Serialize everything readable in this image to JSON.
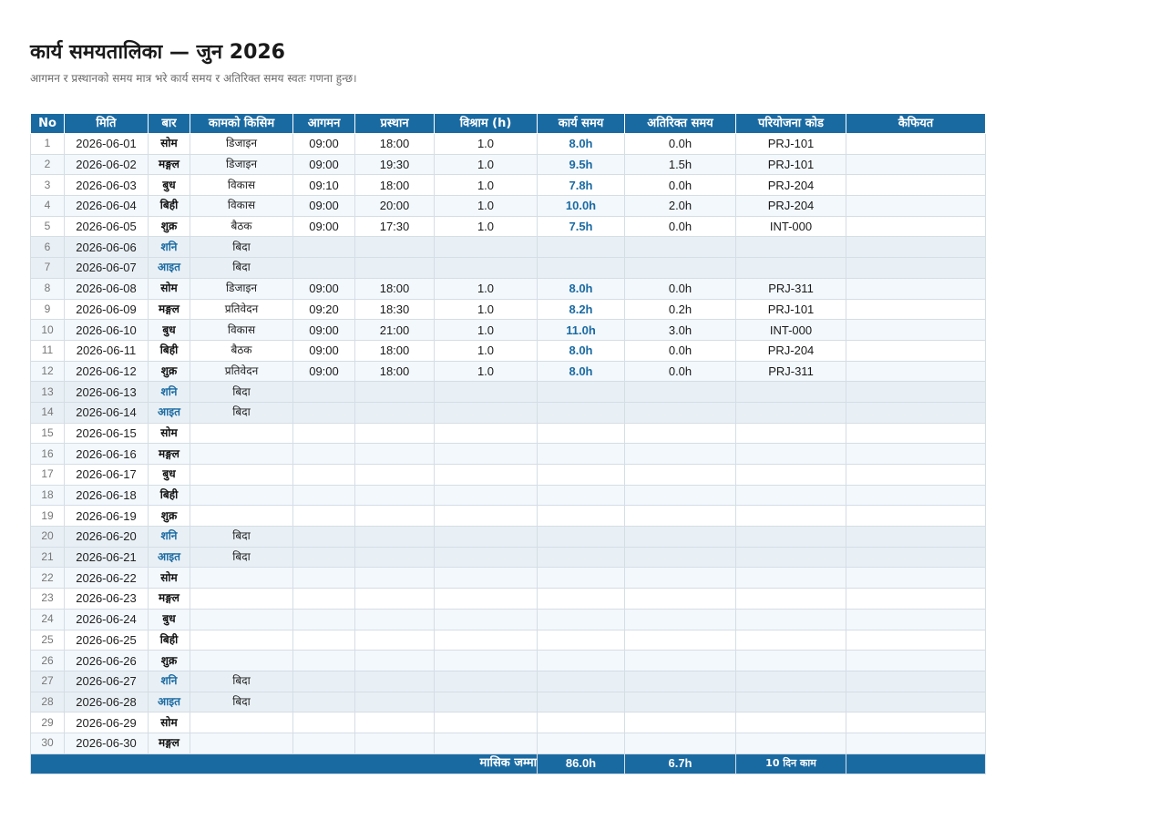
{
  "title": "कार्य समयतालिका — जुन 2026",
  "subtitle": "आगमन र प्रस्थानको समय मात्र भरे कार्य समय र अतिरिक्त समय स्वतः गणना हुन्छ।",
  "colors": {
    "header_bg": "#1a6aa2",
    "accent": "#1a6aa2",
    "weekend_row": "#e9f0f5",
    "alt_row": "#f3f8fc"
  },
  "columns": [
    "No",
    "मिति",
    "बार",
    "कामको किसिम",
    "आगमन",
    "प्रस्थान",
    "विश्राम (h)",
    "कार्य समय",
    "अतिरिक्त समय",
    "परियोजना कोड",
    "कैफियत"
  ],
  "rows": [
    {
      "no": "1",
      "date": "2026-06-01",
      "weekday": "सोम",
      "weekend": false,
      "type": "डिजाइन",
      "in": "09:00",
      "out": "18:00",
      "break": "1.0",
      "work": "8.0h",
      "overtime": "0.0h",
      "project": "PRJ-101",
      "note": ""
    },
    {
      "no": "2",
      "date": "2026-06-02",
      "weekday": "मङ्गल",
      "weekend": false,
      "type": "डिजाइन",
      "in": "09:00",
      "out": "19:30",
      "break": "1.0",
      "work": "9.5h",
      "overtime": "1.5h",
      "project": "PRJ-101",
      "note": ""
    },
    {
      "no": "3",
      "date": "2026-06-03",
      "weekday": "बुध",
      "weekend": false,
      "type": "विकास",
      "in": "09:10",
      "out": "18:00",
      "break": "1.0",
      "work": "7.8h",
      "overtime": "0.0h",
      "project": "PRJ-204",
      "note": ""
    },
    {
      "no": "4",
      "date": "2026-06-04",
      "weekday": "बिही",
      "weekend": false,
      "type": "विकास",
      "in": "09:00",
      "out": "20:00",
      "break": "1.0",
      "work": "10.0h",
      "overtime": "2.0h",
      "project": "PRJ-204",
      "note": ""
    },
    {
      "no": "5",
      "date": "2026-06-05",
      "weekday": "शुक्र",
      "weekend": false,
      "type": "बैठक",
      "in": "09:00",
      "out": "17:30",
      "break": "1.0",
      "work": "7.5h",
      "overtime": "0.0h",
      "project": "INT-000",
      "note": ""
    },
    {
      "no": "6",
      "date": "2026-06-06",
      "weekday": "शनि",
      "weekend": true,
      "type": "बिदा",
      "in": "",
      "out": "",
      "break": "",
      "work": "",
      "overtime": "",
      "project": "",
      "note": ""
    },
    {
      "no": "7",
      "date": "2026-06-07",
      "weekday": "आइत",
      "weekend": true,
      "type": "बिदा",
      "in": "",
      "out": "",
      "break": "",
      "work": "",
      "overtime": "",
      "project": "",
      "note": ""
    },
    {
      "no": "8",
      "date": "2026-06-08",
      "weekday": "सोम",
      "weekend": false,
      "type": "डिजाइन",
      "in": "09:00",
      "out": "18:00",
      "break": "1.0",
      "work": "8.0h",
      "overtime": "0.0h",
      "project": "PRJ-311",
      "note": ""
    },
    {
      "no": "9",
      "date": "2026-06-09",
      "weekday": "मङ्गल",
      "weekend": false,
      "type": "प्रतिवेदन",
      "in": "09:20",
      "out": "18:30",
      "break": "1.0",
      "work": "8.2h",
      "overtime": "0.2h",
      "project": "PRJ-101",
      "note": ""
    },
    {
      "no": "10",
      "date": "2026-06-10",
      "weekday": "बुध",
      "weekend": false,
      "type": "विकास",
      "in": "09:00",
      "out": "21:00",
      "break": "1.0",
      "work": "11.0h",
      "overtime": "3.0h",
      "project": "INT-000",
      "note": ""
    },
    {
      "no": "11",
      "date": "2026-06-11",
      "weekday": "बिही",
      "weekend": false,
      "type": "बैठक",
      "in": "09:00",
      "out": "18:00",
      "break": "1.0",
      "work": "8.0h",
      "overtime": "0.0h",
      "project": "PRJ-204",
      "note": ""
    },
    {
      "no": "12",
      "date": "2026-06-12",
      "weekday": "शुक्र",
      "weekend": false,
      "type": "प्रतिवेदन",
      "in": "09:00",
      "out": "18:00",
      "break": "1.0",
      "work": "8.0h",
      "overtime": "0.0h",
      "project": "PRJ-311",
      "note": ""
    },
    {
      "no": "13",
      "date": "2026-06-13",
      "weekday": "शनि",
      "weekend": true,
      "type": "बिदा",
      "in": "",
      "out": "",
      "break": "",
      "work": "",
      "overtime": "",
      "project": "",
      "note": ""
    },
    {
      "no": "14",
      "date": "2026-06-14",
      "weekday": "आइत",
      "weekend": true,
      "type": "बिदा",
      "in": "",
      "out": "",
      "break": "",
      "work": "",
      "overtime": "",
      "project": "",
      "note": ""
    },
    {
      "no": "15",
      "date": "2026-06-15",
      "weekday": "सोम",
      "weekend": false,
      "type": "",
      "in": "",
      "out": "",
      "break": "",
      "work": "",
      "overtime": "",
      "project": "",
      "note": ""
    },
    {
      "no": "16",
      "date": "2026-06-16",
      "weekday": "मङ्गल",
      "weekend": false,
      "type": "",
      "in": "",
      "out": "",
      "break": "",
      "work": "",
      "overtime": "",
      "project": "",
      "note": ""
    },
    {
      "no": "17",
      "date": "2026-06-17",
      "weekday": "बुध",
      "weekend": false,
      "type": "",
      "in": "",
      "out": "",
      "break": "",
      "work": "",
      "overtime": "",
      "project": "",
      "note": ""
    },
    {
      "no": "18",
      "date": "2026-06-18",
      "weekday": "बिही",
      "weekend": false,
      "type": "",
      "in": "",
      "out": "",
      "break": "",
      "work": "",
      "overtime": "",
      "project": "",
      "note": ""
    },
    {
      "no": "19",
      "date": "2026-06-19",
      "weekday": "शुक्र",
      "weekend": false,
      "type": "",
      "in": "",
      "out": "",
      "break": "",
      "work": "",
      "overtime": "",
      "project": "",
      "note": ""
    },
    {
      "no": "20",
      "date": "2026-06-20",
      "weekday": "शनि",
      "weekend": true,
      "type": "बिदा",
      "in": "",
      "out": "",
      "break": "",
      "work": "",
      "overtime": "",
      "project": "",
      "note": ""
    },
    {
      "no": "21",
      "date": "2026-06-21",
      "weekday": "आइत",
      "weekend": true,
      "type": "बिदा",
      "in": "",
      "out": "",
      "break": "",
      "work": "",
      "overtime": "",
      "project": "",
      "note": ""
    },
    {
      "no": "22",
      "date": "2026-06-22",
      "weekday": "सोम",
      "weekend": false,
      "type": "",
      "in": "",
      "out": "",
      "break": "",
      "work": "",
      "overtime": "",
      "project": "",
      "note": ""
    },
    {
      "no": "23",
      "date": "2026-06-23",
      "weekday": "मङ्गल",
      "weekend": false,
      "type": "",
      "in": "",
      "out": "",
      "break": "",
      "work": "",
      "overtime": "",
      "project": "",
      "note": ""
    },
    {
      "no": "24",
      "date": "2026-06-24",
      "weekday": "बुध",
      "weekend": false,
      "type": "",
      "in": "",
      "out": "",
      "break": "",
      "work": "",
      "overtime": "",
      "project": "",
      "note": ""
    },
    {
      "no": "25",
      "date": "2026-06-25",
      "weekday": "बिही",
      "weekend": false,
      "type": "",
      "in": "",
      "out": "",
      "break": "",
      "work": "",
      "overtime": "",
      "project": "",
      "note": ""
    },
    {
      "no": "26",
      "date": "2026-06-26",
      "weekday": "शुक्र",
      "weekend": false,
      "type": "",
      "in": "",
      "out": "",
      "break": "",
      "work": "",
      "overtime": "",
      "project": "",
      "note": ""
    },
    {
      "no": "27",
      "date": "2026-06-27",
      "weekday": "शनि",
      "weekend": true,
      "type": "बिदा",
      "in": "",
      "out": "",
      "break": "",
      "work": "",
      "overtime": "",
      "project": "",
      "note": ""
    },
    {
      "no": "28",
      "date": "2026-06-28",
      "weekday": "आइत",
      "weekend": true,
      "type": "बिदा",
      "in": "",
      "out": "",
      "break": "",
      "work": "",
      "overtime": "",
      "project": "",
      "note": ""
    },
    {
      "no": "29",
      "date": "2026-06-29",
      "weekday": "सोम",
      "weekend": false,
      "type": "",
      "in": "",
      "out": "",
      "break": "",
      "work": "",
      "overtime": "",
      "project": "",
      "note": ""
    },
    {
      "no": "30",
      "date": "2026-06-30",
      "weekday": "मङ्गल",
      "weekend": false,
      "type": "",
      "in": "",
      "out": "",
      "break": "",
      "work": "",
      "overtime": "",
      "project": "",
      "note": ""
    }
  ],
  "totals": {
    "label": "मासिक जम्मा",
    "work": "86.0h",
    "overtime": "6.7h",
    "days": "10 दिन काम"
  }
}
